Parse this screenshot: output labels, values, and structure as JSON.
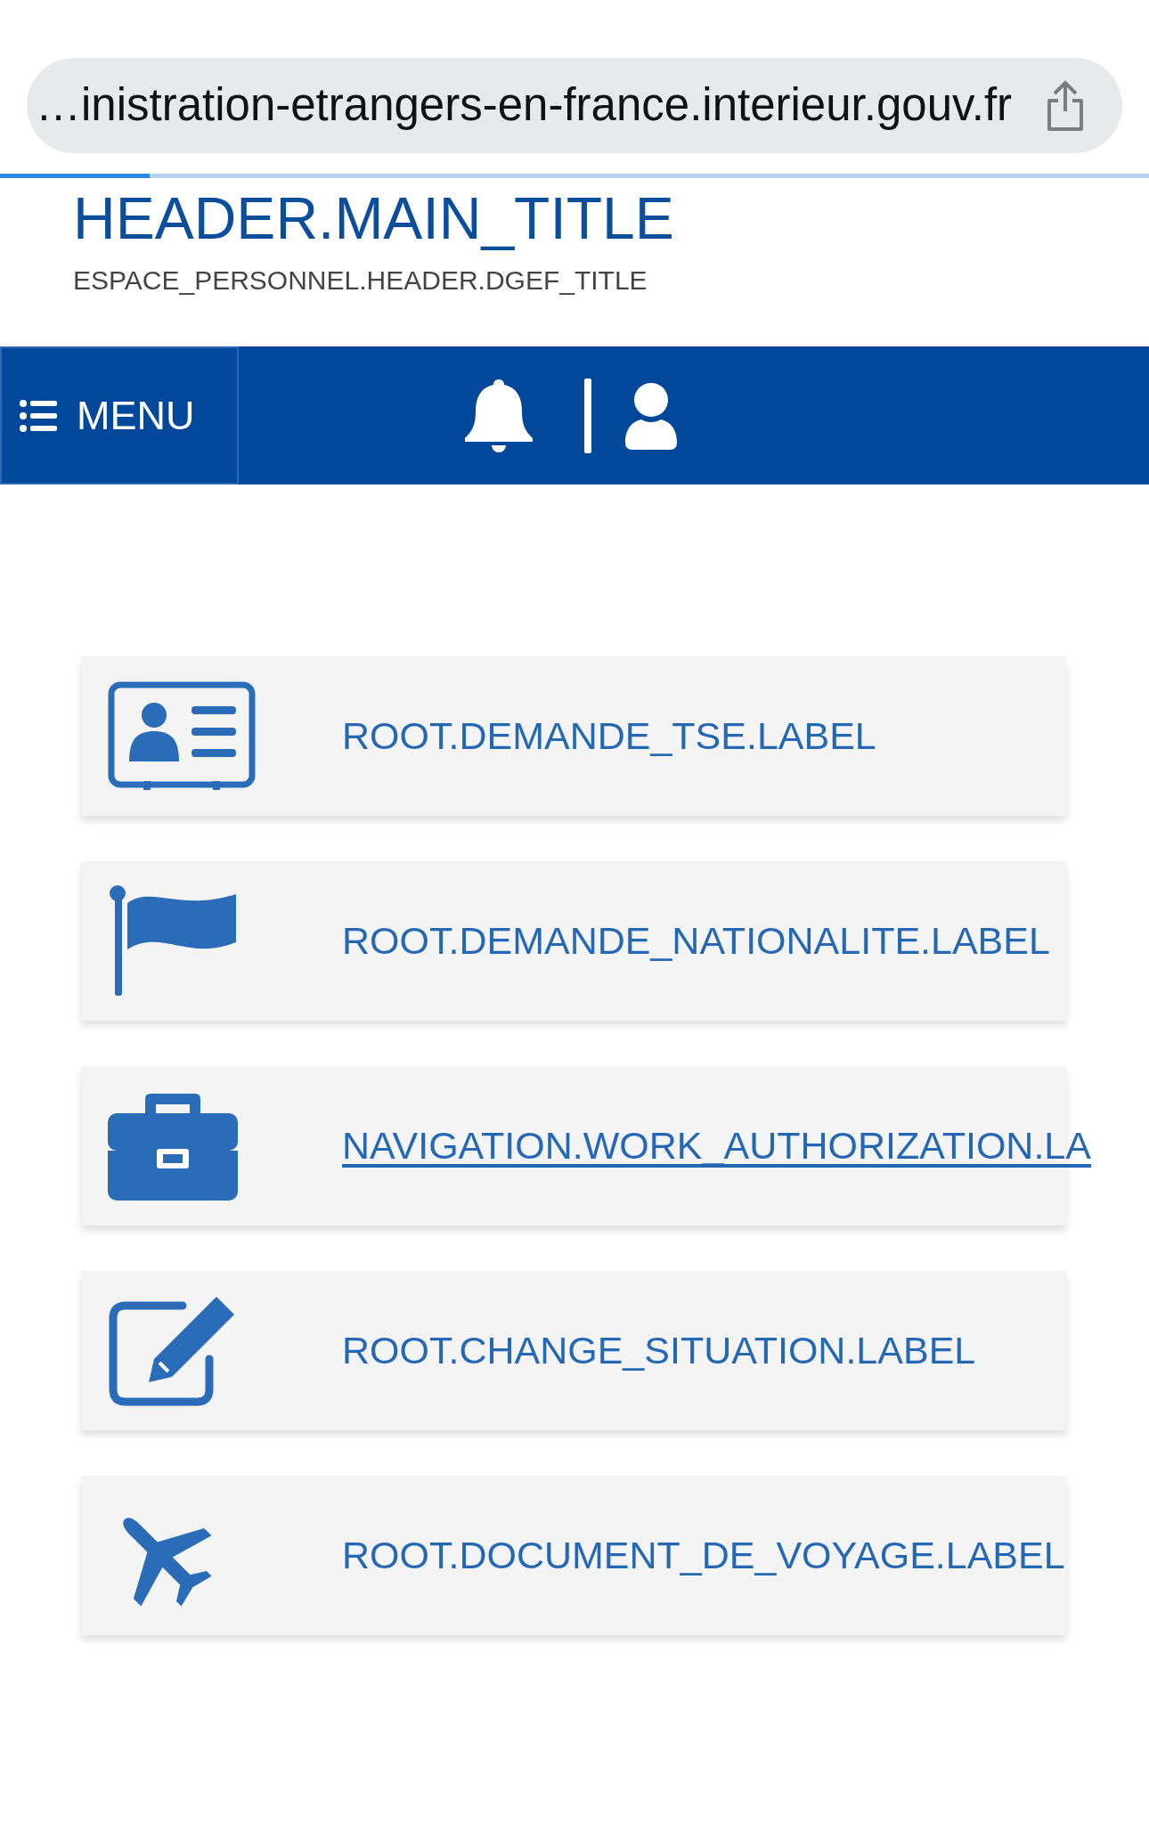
{
  "address_bar": {
    "url": "…inistration-etrangers-en-france.interieur.gouv.fr"
  },
  "page_load": {
    "level": 0.13
  },
  "header": {
    "title": "HEADER.MAIN_TITLE",
    "subtitle": "ESPACE_PERSONNEL.HEADER.DGEF_TITLE"
  },
  "navbar": {
    "menu_label": "MENU"
  },
  "services": [
    {
      "label": "ROOT.DEMANDE_TSE.LABEL",
      "focused": false
    },
    {
      "label": "ROOT.DEMANDE_NATIONALITE.LABEL",
      "focused": false
    },
    {
      "label": "NAVIGATION.WORK_AUTHORIZATION.LA",
      "focused": true
    },
    {
      "label": "ROOT.CHANGE_SITUATION.LABEL",
      "focused": false
    },
    {
      "label": "ROOT.DOCUMENT_DE_VOYAGE.LABEL",
      "focused": false
    }
  ]
}
